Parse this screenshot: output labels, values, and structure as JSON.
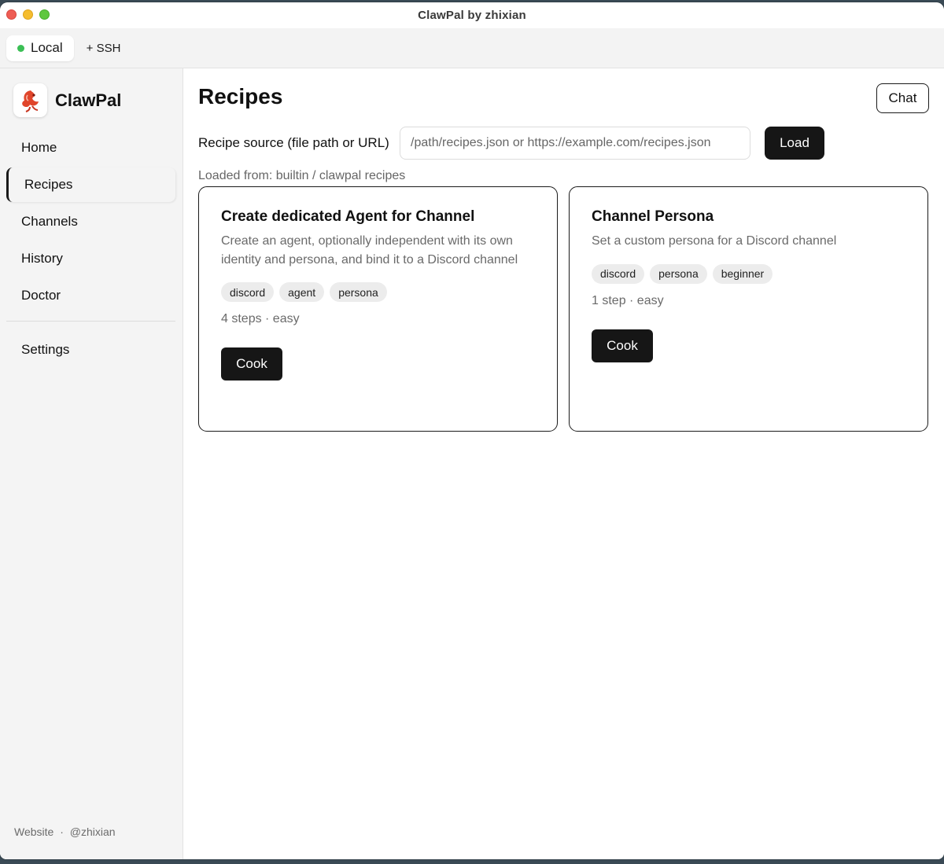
{
  "window": {
    "title": "ClawPal by zhixian"
  },
  "connections": {
    "local_label": "Local",
    "ssh_label": "+ SSH",
    "status_color": "#3bbf55"
  },
  "sidebar": {
    "brand": "ClawPal",
    "items": [
      {
        "label": "Home"
      },
      {
        "label": "Recipes",
        "active": true
      },
      {
        "label": "Channels"
      },
      {
        "label": "History"
      },
      {
        "label": "Doctor"
      }
    ],
    "settings_label": "Settings",
    "footer": {
      "website": "Website",
      "separator": "·",
      "author": "@zhixian"
    }
  },
  "main": {
    "title": "Recipes",
    "chat_label": "Chat",
    "source_label": "Recipe source (file path or URL)",
    "source_placeholder": "/path/recipes.json or https://example.com/recipes.json",
    "load_label": "Load",
    "loaded_from": "Loaded from: builtin / clawpal recipes",
    "recipes": [
      {
        "title": "Create dedicated Agent for Channel",
        "description": "Create an agent, optionally independent with its own identity and persona, and bind it to a Discord channel",
        "tags": [
          "discord",
          "agent",
          "persona"
        ],
        "meta": "4 steps · easy",
        "action": "Cook"
      },
      {
        "title": "Channel Persona",
        "description": "Set a custom persona for a Discord channel",
        "tags": [
          "discord",
          "persona",
          "beginner"
        ],
        "meta": "1 step · easy",
        "action": "Cook"
      }
    ]
  },
  "colors": {
    "primary_button": "#161616",
    "accent_logo": "#e0452b"
  }
}
